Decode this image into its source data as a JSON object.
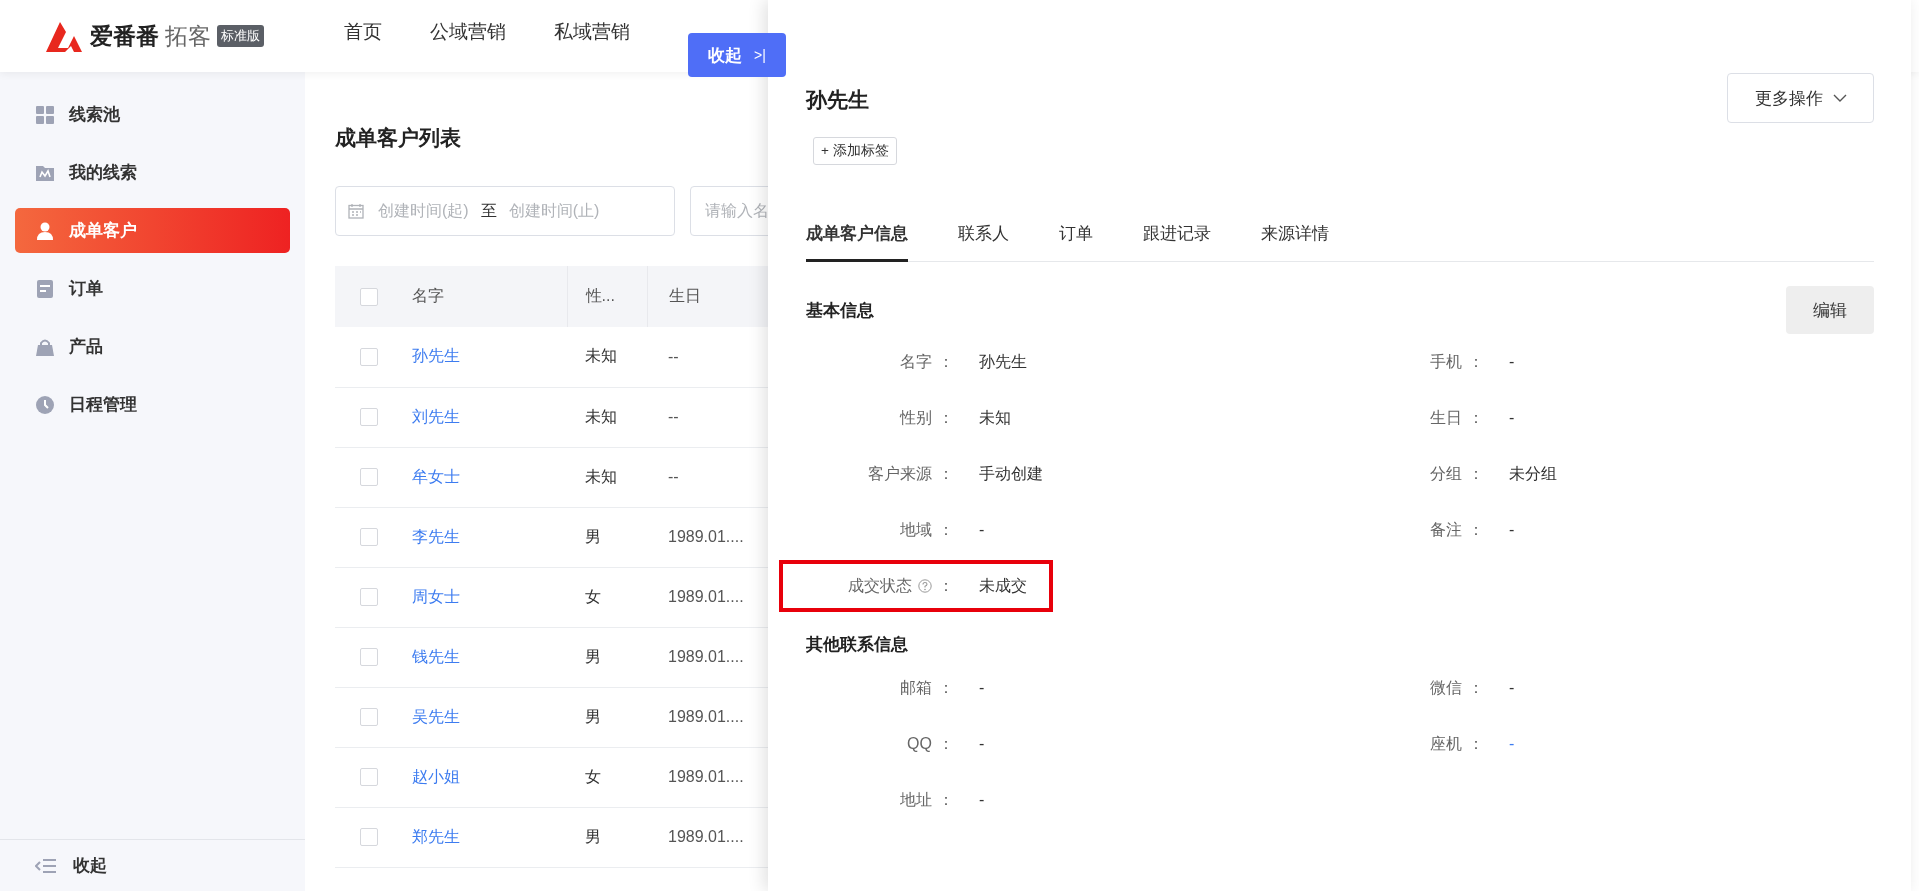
{
  "header": {
    "logo": {
      "brand": "爱番番",
      "product": "拓客",
      "edition": "标准版"
    },
    "nav": [
      {
        "label": "首页",
        "selected": false
      },
      {
        "label": "公域营销",
        "selected": false
      },
      {
        "label": "私域营销",
        "selected": false
      }
    ]
  },
  "sidebar": {
    "items": [
      {
        "label": "线索池",
        "selected": false
      },
      {
        "label": "我的线索",
        "selected": false
      },
      {
        "label": "成单客户",
        "selected": true
      },
      {
        "label": "订单",
        "selected": false
      },
      {
        "label": "产品",
        "selected": false
      },
      {
        "label": "日程管理",
        "selected": false
      }
    ],
    "collapse": "收起"
  },
  "main": {
    "title": "成单客户列表",
    "filters": {
      "start_placeholder": "创建时间(起)",
      "separator": "至",
      "end_placeholder": "创建时间(止)",
      "search_placeholder": "请输入名"
    },
    "table": {
      "header_checked": false,
      "columns": [
        "名字",
        "性...",
        "生日"
      ],
      "rows": [
        {
          "checked": false,
          "cells": [
            "孙先生",
            "未知",
            "--"
          ]
        },
        {
          "checked": false,
          "cells": [
            "刘先生",
            "未知",
            "--"
          ]
        },
        {
          "checked": false,
          "cells": [
            "牟女士",
            "未知",
            "--"
          ]
        },
        {
          "checked": false,
          "cells": [
            "李先生",
            "男",
            "1989.01...."
          ]
        },
        {
          "checked": false,
          "cells": [
            "周女士",
            "女",
            "1989.01...."
          ]
        },
        {
          "checked": false,
          "cells": [
            "钱先生",
            "男",
            "1989.01...."
          ]
        },
        {
          "checked": false,
          "cells": [
            "吴先生",
            "男",
            "1989.01...."
          ]
        },
        {
          "checked": false,
          "cells": [
            "赵小姐",
            "女",
            "1989.01...."
          ]
        },
        {
          "checked": false,
          "cells": [
            "郑先生",
            "男",
            "1989.01...."
          ]
        }
      ]
    }
  },
  "drawer": {
    "collapse_button": "收起",
    "collapse_icon": ">|",
    "name": "孙先生",
    "more_button": "更多操作",
    "add_tag": "+ 添加标签",
    "tabs": [
      {
        "label": "成单客户信息",
        "selected": true
      },
      {
        "label": "联系人",
        "selected": false
      },
      {
        "label": "订单",
        "selected": false
      },
      {
        "label": "跟进记录",
        "selected": false
      },
      {
        "label": "来源详情",
        "selected": false
      }
    ],
    "sections": [
      {
        "title": "基本信息",
        "edit_button": "编辑",
        "fields": [
          {
            "label": "名字",
            "colon": "：",
            "value": "孙先生",
            "kind": "text",
            "help": false,
            "highlighted": false
          },
          {
            "label": "手机",
            "colon": "：",
            "value": "-",
            "kind": "text",
            "help": false,
            "highlighted": false
          },
          {
            "label": "性别",
            "colon": "：",
            "value": "未知",
            "kind": "text",
            "help": false,
            "highlighted": false
          },
          {
            "label": "生日",
            "colon": "：",
            "value": "-",
            "kind": "text",
            "help": false,
            "highlighted": false
          },
          {
            "label": "客户来源",
            "colon": "：",
            "value": "手动创建",
            "kind": "text",
            "help": false,
            "highlighted": false
          },
          {
            "label": "分组",
            "colon": "：",
            "value": "未分组",
            "kind": "text",
            "help": false,
            "highlighted": false
          },
          {
            "label": "地域",
            "colon": "：",
            "value": "-",
            "kind": "text",
            "help": false,
            "highlighted": false
          },
          {
            "label": "备注",
            "colon": "：",
            "value": "-",
            "kind": "text",
            "help": false,
            "highlighted": false
          },
          {
            "label": "成交状态",
            "colon": "：",
            "value": "未成交",
            "kind": "text",
            "help": true,
            "highlighted": true
          }
        ]
      },
      {
        "title": "其他联系信息",
        "fields": [
          {
            "label": "邮箱",
            "colon": "：",
            "value": "-",
            "kind": "text",
            "help": false,
            "highlighted": false
          },
          {
            "label": "微信",
            "colon": "：",
            "value": "-",
            "kind": "text",
            "help": false,
            "highlighted": false
          },
          {
            "label": "QQ",
            "colon": "：",
            "value": "-",
            "kind": "text",
            "help": false,
            "highlighted": false
          },
          {
            "label": "座机",
            "colon": "：",
            "value": "-",
            "kind": "link",
            "help": false,
            "highlighted": false
          },
          {
            "label": "地址",
            "colon": "：",
            "value": "-",
            "kind": "text",
            "help": false,
            "highlighted": false
          }
        ]
      }
    ]
  }
}
